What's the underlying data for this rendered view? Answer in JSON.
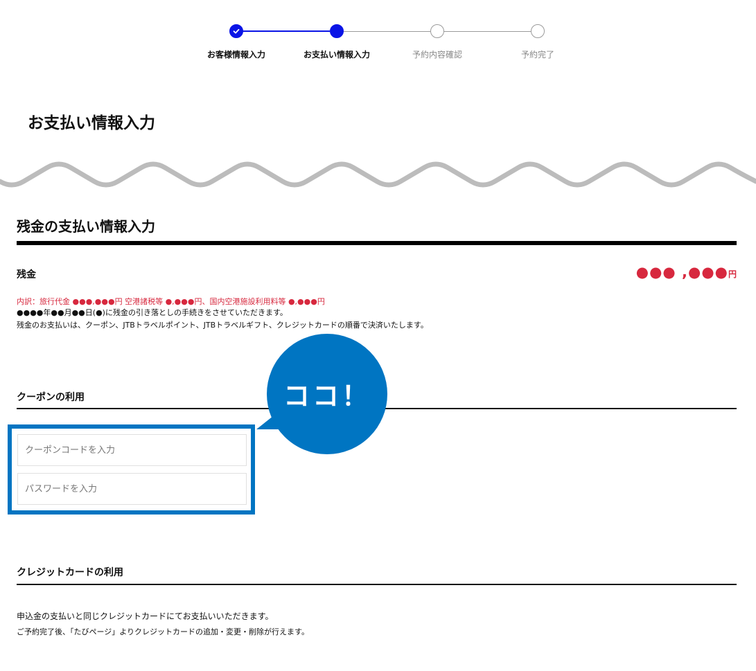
{
  "stepper": {
    "steps": [
      {
        "label": "お客様情報入力",
        "state": "done"
      },
      {
        "label": "お支払い情報入力",
        "state": "active"
      },
      {
        "label": "予約内容確認",
        "state": "todo"
      },
      {
        "label": "予約完了",
        "state": "todo"
      }
    ],
    "active_color": "#0a14e6",
    "inactive_color": "#9a9a9a"
  },
  "page": {
    "title": "お支払い情報入力"
  },
  "balance_section": {
    "title": "残金の支払い情報入力",
    "balance_label": "残金",
    "balance_amount": "●●● ,●●●",
    "balance_unit": "円",
    "breakdown": "内訳：旅行代金 ●●●,●●●円  空港諸税等 ●,●●●円、国内空港施設利用料等 ●,●●●円",
    "note1": "●●●●年●●月●●日(●)に残金の引き落としの手続きをさせていただきます。",
    "note2": "残金のお支払いは、クーポン、JTBトラベルポイント、JTBトラベルギフト、クレジットカードの順番で決済いたします。",
    "accent_color": "#d7283e"
  },
  "coupon_section": {
    "title": "クーポンの利用",
    "code_placeholder": "クーポンコードを入力",
    "password_placeholder": "パスワードを入力"
  },
  "callout": {
    "text": "ココ！",
    "color": "#0075c2"
  },
  "credit_section": {
    "title": "クレジットカードの利用",
    "note1": "申込金の支払いと同じクレジットカードにてお支払いいただきます。",
    "note2": "ご予約完了後、「たびページ」よりクレジットカードの追加・変更・削除が行えます。"
  }
}
